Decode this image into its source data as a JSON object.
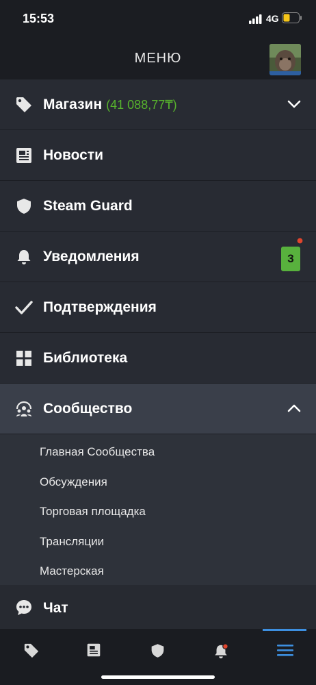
{
  "status": {
    "time": "15:53",
    "network": "4G"
  },
  "header": {
    "title": "МЕНЮ"
  },
  "menu": {
    "store": {
      "label": "Магазин",
      "balance": "(41 088,77₸)"
    },
    "news": {
      "label": "Новости"
    },
    "guard": {
      "label": "Steam Guard"
    },
    "notifications": {
      "label": "Уведомления",
      "badge": "3"
    },
    "confirmations": {
      "label": "Подтверждения"
    },
    "library": {
      "label": "Библиотека"
    },
    "community": {
      "label": "Сообщество",
      "items": [
        "Главная Сообщества",
        "Обсуждения",
        "Торговая площадка",
        "Трансляции",
        "Мастерская"
      ]
    },
    "chat": {
      "label": "Чат"
    }
  },
  "colors": {
    "accent": "#3d8fe0",
    "balance": "#57b32d",
    "badge": "#58b13d",
    "alert": "#e0452d"
  },
  "tabbar": {
    "icons": [
      "tag-icon",
      "news-icon",
      "shield-icon",
      "bell-icon",
      "menu-icon"
    ],
    "active": "menu-icon"
  }
}
